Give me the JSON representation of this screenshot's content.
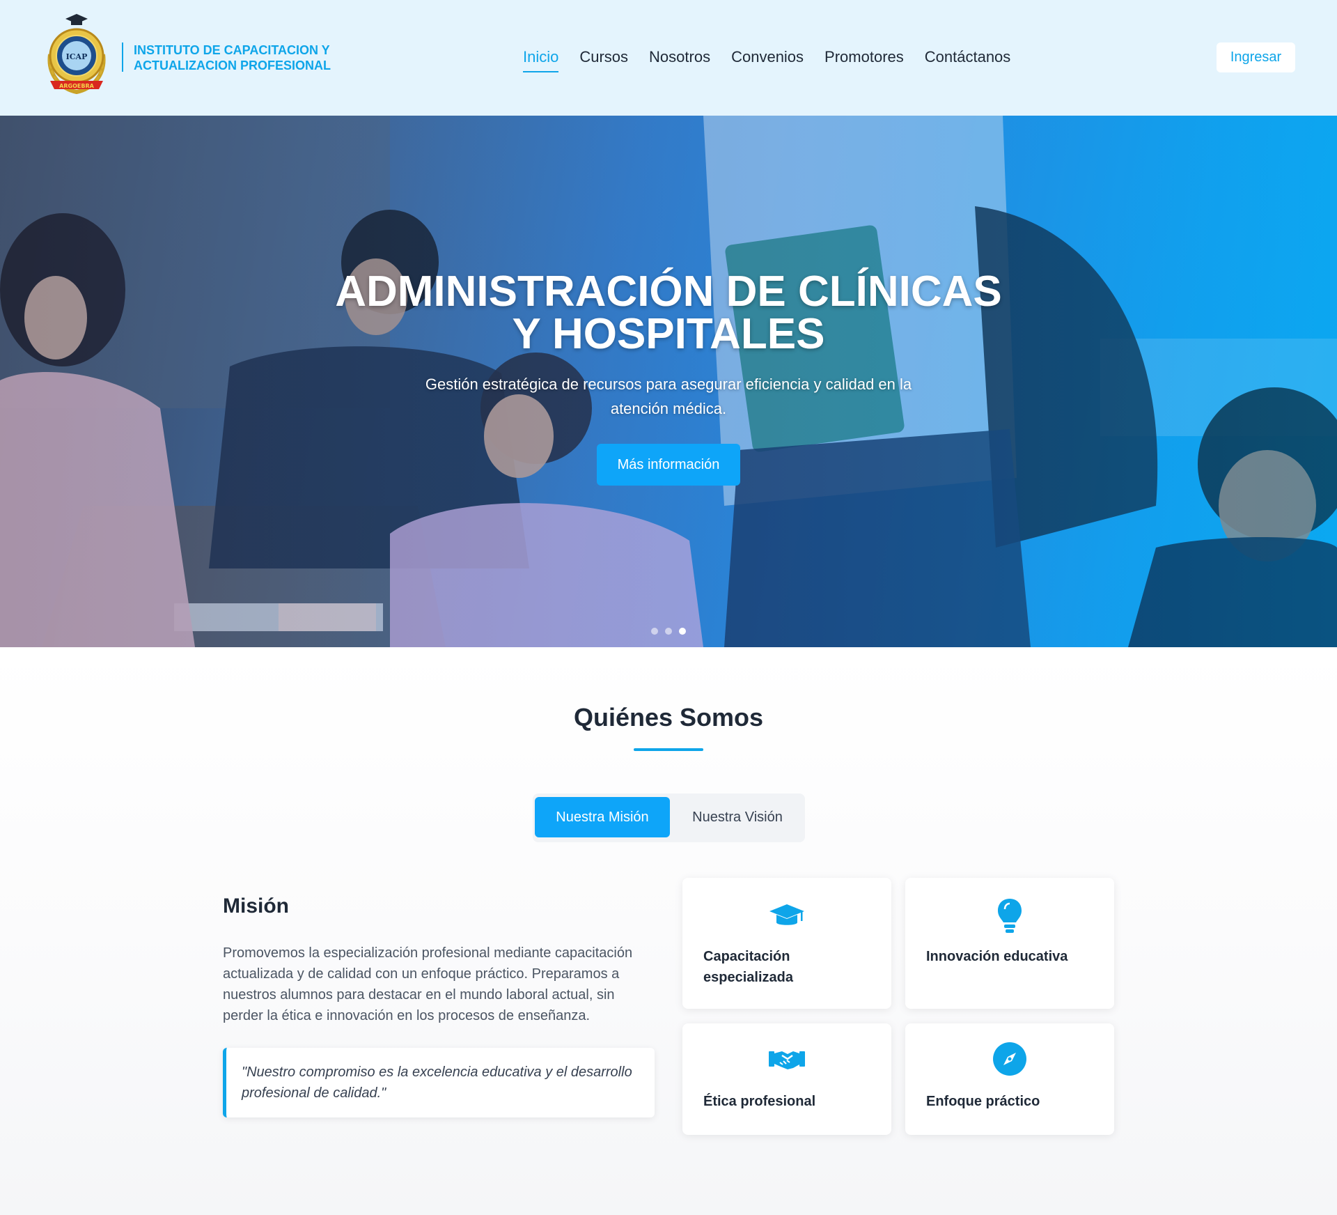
{
  "brand": {
    "logo_text": "ICAP",
    "logo_ribbon": "ARGOEBRA",
    "name_line1": "INSTITUTO DE CAPACITACION Y",
    "name_line2": "ACTUALIZACION PROFESIONAL"
  },
  "nav": {
    "items": [
      "Inicio",
      "Cursos",
      "Nosotros",
      "Convenios",
      "Promotores",
      "Contáctanos"
    ],
    "active": "Inicio",
    "login_label": "Ingresar"
  },
  "hero": {
    "title_line1": "ADMINISTRACIÓN DE CLÍNICAS",
    "title_line2": "Y HOSPITALES",
    "subtitle_line1": "Gestión estratégica de recursos para asegurar eficiencia y calidad en la",
    "subtitle_line2": "atención médica.",
    "button_label": "Más información",
    "slides": 3,
    "active_slide": 3
  },
  "about": {
    "title": "Quiénes Somos",
    "tabs": [
      "Nuestra Misión",
      "Nuestra Visión"
    ],
    "active_tab": "Nuestra Misión",
    "mission_title": "Misión",
    "mission_text": "Promovemos la especialización profesional mediante capacitación actualizada y de calidad con un enfoque práctico. Preparamos a nuestros alumnos para destacar en el mundo laboral actual, sin perder la ética e innovación en los procesos de enseñanza.",
    "quote": "\"Nuestro compromiso es la excelencia educativa y el desarrollo profesional de calidad.\"",
    "features": [
      {
        "label": "Capacitación especializada",
        "icon": "graduation-cap-icon"
      },
      {
        "label": "Innovación educativa",
        "icon": "lightbulb-icon"
      },
      {
        "label": "Ética profesional",
        "icon": "handshake-icon"
      },
      {
        "label": "Enfoque práctico",
        "icon": "compass-icon"
      }
    ]
  },
  "colors": {
    "accent": "#0ea5e9",
    "header_bg": "#e4f4fd",
    "text_dark": "#1f2937"
  }
}
